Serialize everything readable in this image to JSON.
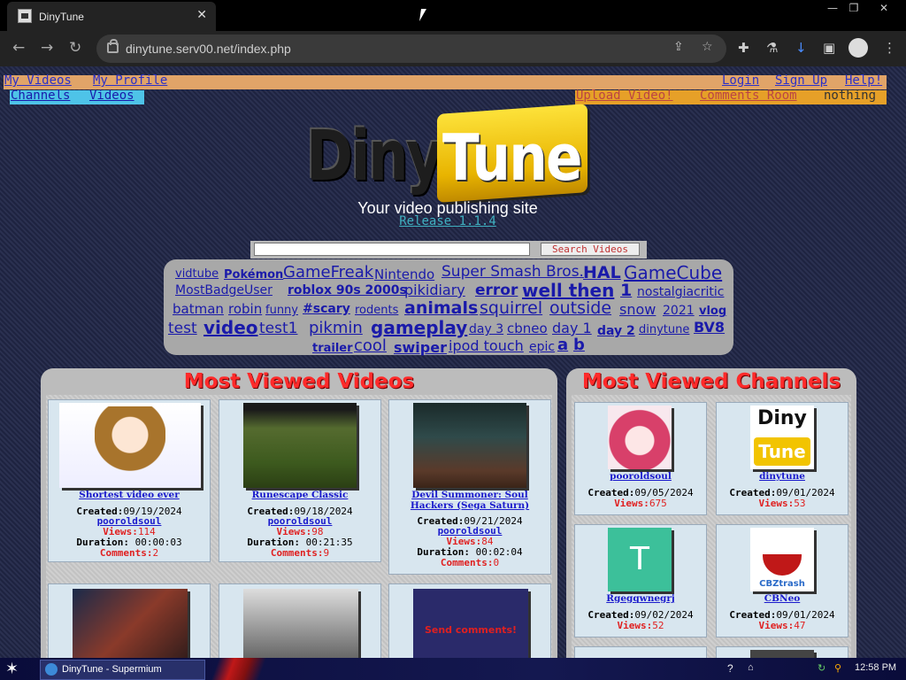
{
  "browser": {
    "tab_title": "DinyTune",
    "url": "dinytune.serv00.net/index.php",
    "window_controls": [
      "—",
      "❐",
      "✕"
    ]
  },
  "site": {
    "top_left_links": [
      "My Videos",
      "My Profile"
    ],
    "top_right_links": [
      "Login",
      "Sign Up",
      "Help!"
    ],
    "channels_links": [
      "Channels",
      "Videos"
    ],
    "upload_link": "Upload Video!",
    "comments_link": "Comments Room",
    "nothing_text": "nothing",
    "logo_left": "Diny",
    "logo_right": "Tune",
    "tagline": "Your video publishing site",
    "release": "Release 1.1.4",
    "search_button": "Search Videos",
    "search_value": ""
  },
  "tags": [
    "vidtube",
    "Pokémon",
    "GameFreak",
    "Nintendo",
    "Super Smash Bros.",
    "HAL",
    "GameCube",
    "MostBadgeUser",
    "roblox 90s 2000s",
    "pikidiary",
    "error",
    "well then",
    "1",
    "nostalgiacritic",
    "batman",
    "robin",
    "funny",
    "#scary",
    "rodents",
    "animals",
    "squirrel",
    "outside",
    "snow",
    "2021",
    "vlog",
    "test",
    "video",
    "test1",
    "pikmin",
    "gameplay",
    "day 3",
    "cbneo",
    "day 1",
    "day 2",
    "dinytune",
    "BV8",
    "trailer",
    "cool",
    "swiper",
    "ipod touch",
    "epic",
    "a",
    "b"
  ],
  "videos_panel": {
    "title": "Most Viewed Videos",
    "labels": {
      "created": "Created:",
      "views": "Views:",
      "duration": "Duration:",
      "comments": "Comments:"
    },
    "items": [
      {
        "title": "Shortest video ever",
        "created": "09/19/2024",
        "author": "pooroldsoul",
        "views": "114",
        "duration": "00:00:03",
        "comments": "2"
      },
      {
        "title": "Runescape Classic",
        "created": "09/18/2024",
        "author": "pooroldsoul",
        "views": "98",
        "duration": "00:21:35",
        "comments": "9"
      },
      {
        "title": "Devil Summoner: Soul Hackers (Sega Saturn)",
        "created": "09/21/2024",
        "author": "pooroldsoul",
        "views": "84",
        "duration": "00:02:04",
        "comments": "0"
      }
    ],
    "partial_thumb_text": "Send comments!"
  },
  "channels_panel": {
    "title": "Most Viewed Channels",
    "items": [
      {
        "name": "pooroldsoul",
        "created": "09/05/2024",
        "views": "675"
      },
      {
        "name": "dinytune",
        "created": "09/01/2024",
        "views": "53"
      },
      {
        "name": "Rgegqwnegrj",
        "created": "09/02/2024",
        "views": "52",
        "avatar_letter": "T"
      },
      {
        "name": "CBNeo",
        "created": "09/01/2024",
        "views": "47",
        "avatar_caption": "CBZtrash"
      }
    ],
    "dinytune_avatar": [
      "Diny",
      "Tune"
    ]
  },
  "taskbar": {
    "task_label": "DinyTune - Supermium",
    "clock": "12:58 PM"
  },
  "colors": {
    "accent_red": "#ff2a2a",
    "link_blue": "#1a1acc",
    "tag_bg": "#a8a8a8",
    "orange_bar": "#e1a468"
  }
}
